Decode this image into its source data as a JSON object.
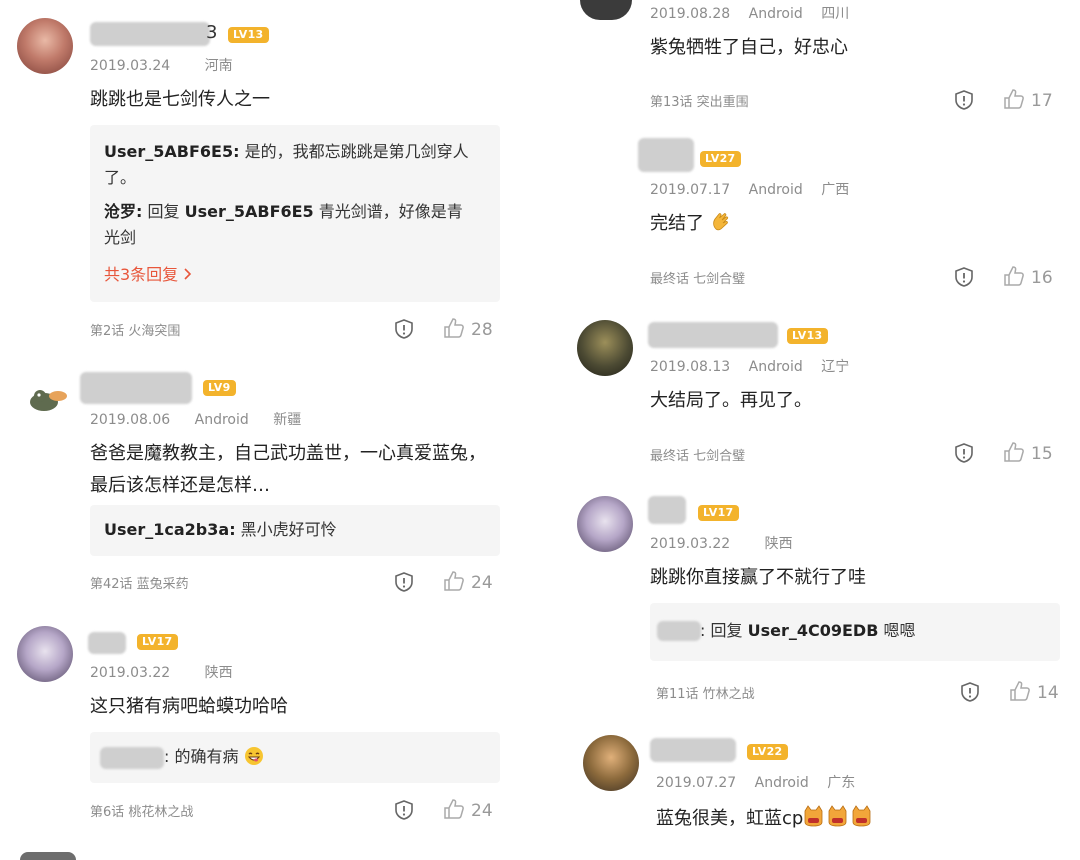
{
  "left": [
    {
      "level": "LV13",
      "date": "2019.03.24",
      "location": "河南",
      "name_tail": "3",
      "text": "跳跳也是七剑传人之一",
      "replies": [
        {
          "user": "User_5ABF6E5:",
          "text": " 是的，我都忘跳跳是第几剑穿人了。"
        },
        {
          "user": "沧罗:",
          "text": " 回复 ",
          "target": "User_5ABF6E5",
          "text2": " 青光剑谱，好像是青光剑"
        }
      ],
      "more": "共3条回复",
      "episode": "第2话 火海突围",
      "likes": "28"
    },
    {
      "level": "LV9",
      "date": "2019.08.06",
      "platform": "Android",
      "location": "新疆",
      "text": "爸爸是魔教教主，自己武功盖世，一心真爱蓝兔，最后该怎样还是怎样…",
      "replies": [
        {
          "user": "User_1ca2b3a:",
          "text": " 黑小虎好可怜"
        }
      ],
      "episode": "第42话 蓝兔采药",
      "likes": "24"
    },
    {
      "level": "LV17",
      "date": "2019.03.22",
      "location": "陕西",
      "text": "这只猪有病吧蛤蟆功哈哈",
      "reply_tail": ": 的确有病",
      "episode": "第6话 桃花林之战",
      "likes": "24"
    }
  ],
  "right": [
    {
      "date": "2019.08.28",
      "platform": "Android",
      "location": "四川",
      "text": "紫兔牺牲了自己，好忠心",
      "episode": "第13话 突出重围",
      "likes": "17"
    },
    {
      "level": "LV27",
      "date": "2019.07.17",
      "platform": "Android",
      "location": "广西",
      "text": "完结了",
      "episode": "最终话 七剑合璧",
      "likes": "16"
    },
    {
      "level": "LV13",
      "date": "2019.08.13",
      "platform": "Android",
      "location": "辽宁",
      "text": "大结局了。再见了。",
      "episode": "最终话 七剑合璧",
      "likes": "15"
    },
    {
      "level": "LV17",
      "date": "2019.03.22",
      "location": "陕西",
      "text": "跳跳你直接赢了不就行了哇",
      "reply_mid": ": 回复 ",
      "reply_target": "User_4C09EDB",
      "reply_text": " 嗯嗯",
      "episode": "第11话 竹林之战",
      "likes": "14"
    },
    {
      "level": "LV22",
      "date": "2019.07.27",
      "platform": "Android",
      "location": "广东",
      "text": "蓝兔很美，虹蓝cp"
    }
  ],
  "colors": {
    "level_badge": "#f3b32c",
    "more_link": "#e8563b",
    "meta": "#8c8c8c",
    "reply_bg": "#f5f5f5"
  },
  "icons": [
    "report-icon",
    "thumbs-up-icon",
    "chevron-right-icon",
    "clap-emoji",
    "grin-emoji",
    "cat-emoji"
  ]
}
